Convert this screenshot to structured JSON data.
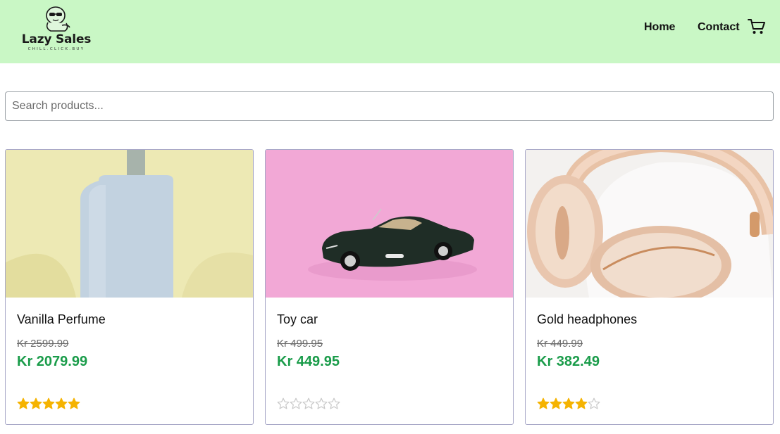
{
  "brand": {
    "name": "Lazy Sales",
    "tagline": "CHILL.CLICK.BUY",
    "logo_icon": "sloth-with-sunglasses-icon"
  },
  "nav": {
    "home_label": "Home",
    "contact_label": "Contact",
    "cart_icon": "cart-icon"
  },
  "search": {
    "placeholder": "Search products...",
    "value": ""
  },
  "colors": {
    "header_bg": "#c9f7c5",
    "price_green": "#1a9c4a",
    "star_gold": "#f5b301",
    "star_empty_outline": "#c8c8c8",
    "card_border": "#a8a8c8"
  },
  "products": [
    {
      "title": "Vanilla Perfume",
      "old_price": "Kr 2599.99",
      "price": "Kr 2079.99",
      "rating": 5,
      "rating_max": 5,
      "image": "perfume-bottle-image"
    },
    {
      "title": "Toy car",
      "old_price": "Kr 499.95",
      "price": "Kr 449.95",
      "rating": 0,
      "rating_max": 5,
      "image": "toy-car-image"
    },
    {
      "title": "Gold headphones",
      "old_price": "Kr 449.99",
      "price": "Kr 382.49",
      "rating": 4,
      "rating_max": 5,
      "image": "headphones-image"
    }
  ]
}
